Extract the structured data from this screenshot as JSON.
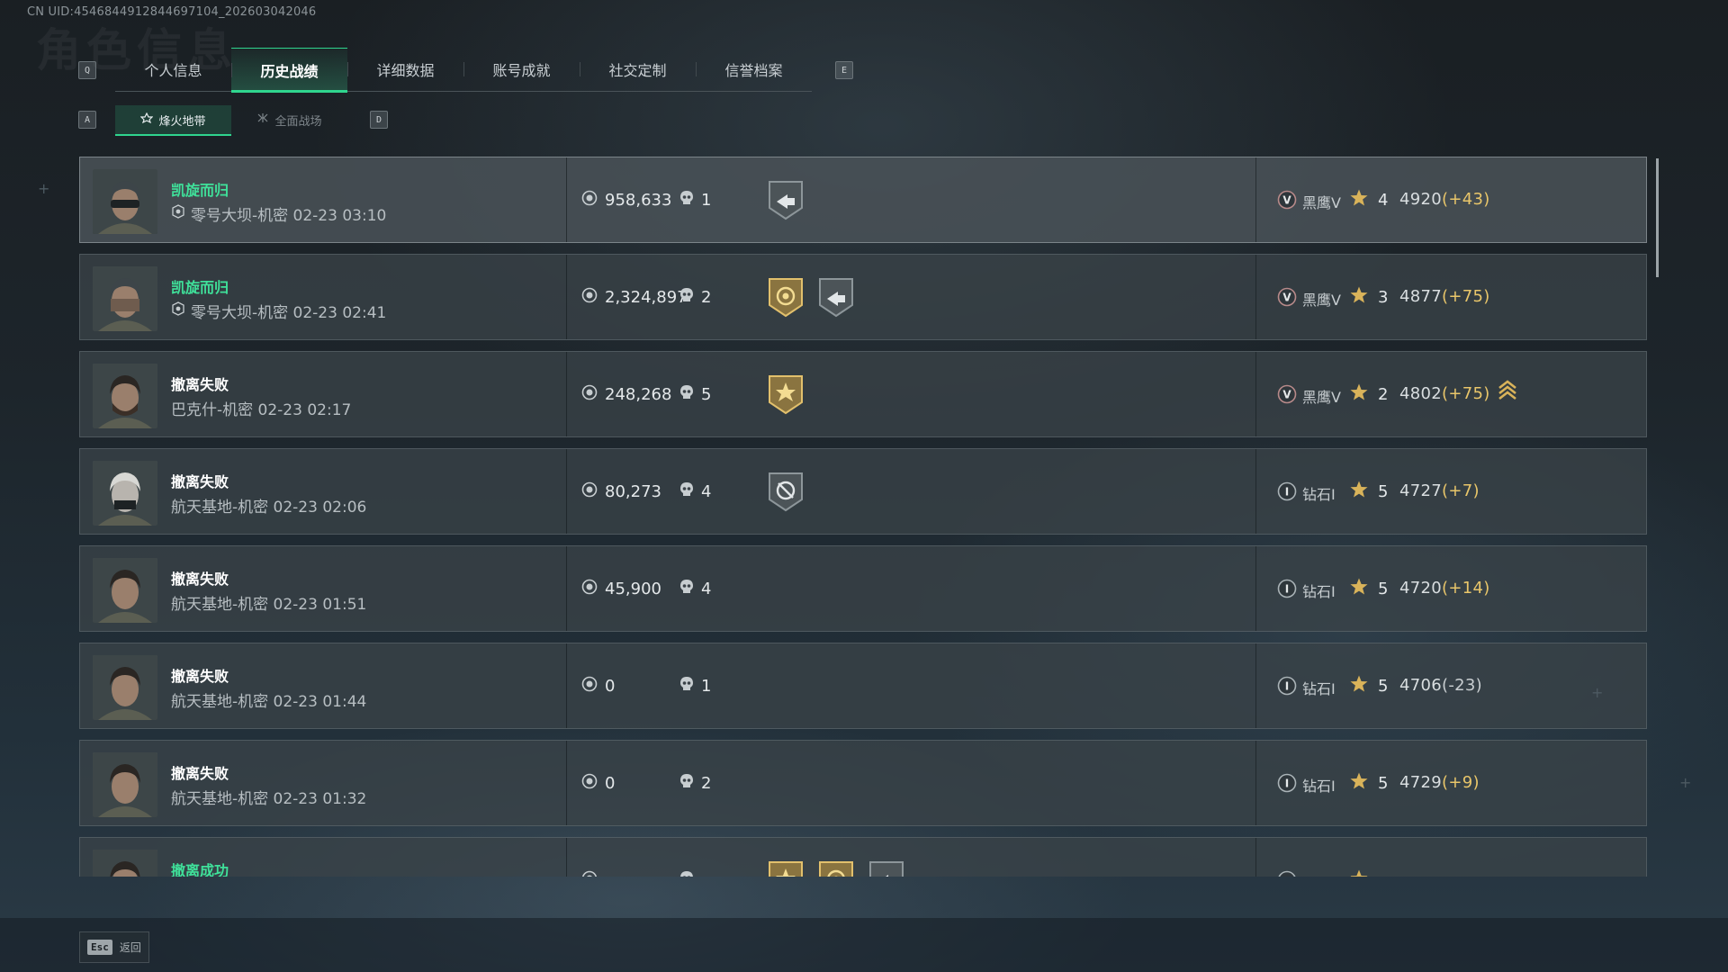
{
  "uid_text": "CN UID:4546844912844697104_202603042046",
  "ghost_title": "角色信息",
  "keys": {
    "tab_prev": "Q",
    "tab_next": "E",
    "sub_prev": "A",
    "sub_next": "D"
  },
  "tabs": [
    {
      "label": "个人信息",
      "active": false
    },
    {
      "label": "历史战绩",
      "active": true
    },
    {
      "label": "详细数据",
      "active": false
    },
    {
      "label": "账号成就",
      "active": false
    },
    {
      "label": "社交定制",
      "active": false
    },
    {
      "label": "信誉档案",
      "active": false
    }
  ],
  "subtabs": [
    {
      "label": "烽火地带",
      "active": true
    },
    {
      "label": "全面战场",
      "active": false
    }
  ],
  "rows": [
    {
      "result": "凯旋而归",
      "success": true,
      "map": "零号大坝-机密 02-23 03:10",
      "map_icon": true,
      "money": "958,633",
      "kills": "1",
      "badges": [
        "extract-grey"
      ],
      "rank": "黑鹰V",
      "rank_numeral": "V",
      "rank_tier": "blackhawk",
      "stars": "4",
      "score": "4920",
      "delta": "(+43)",
      "promo": false,
      "avatar": "helmet"
    },
    {
      "result": "凯旋而归",
      "success": true,
      "map": "零号大坝-机密 02-23 02:41",
      "map_icon": true,
      "money": "2,324,897",
      "kills": "2",
      "badges": [
        "gold-target",
        "extract-grey"
      ],
      "rank": "黑鹰V",
      "rank_numeral": "V",
      "rank_tier": "blackhawk",
      "stars": "3",
      "score": "4877",
      "delta": "(+75)",
      "promo": false,
      "avatar": "masked"
    },
    {
      "result": "撤离失败",
      "success": false,
      "map": "巴克什-机密 02-23 02:17",
      "map_icon": false,
      "money": "248,268",
      "kills": "5",
      "badges": [
        "gold-burst"
      ],
      "rank": "黑鹰V",
      "rank_numeral": "V",
      "rank_tier": "blackhawk",
      "stars": "2",
      "score": "4802",
      "delta": "(+75)",
      "promo": true,
      "avatar": "bearded"
    },
    {
      "result": "撤离失败",
      "success": false,
      "map": "航天基地-机密 02-23 02:06",
      "map_icon": false,
      "money": "80,273",
      "kills": "4",
      "badges": [
        "grey-cycle"
      ],
      "rank": "钻石I",
      "rank_numeral": "I",
      "rank_tier": "diamond",
      "stars": "5",
      "score": "4727",
      "delta": "(+7)",
      "promo": false,
      "avatar": "whitehair"
    },
    {
      "result": "撤离失败",
      "success": false,
      "map": "航天基地-机密 02-23 01:51",
      "map_icon": false,
      "money": "45,900",
      "kills": "4",
      "badges": [],
      "rank": "钻石I",
      "rank_numeral": "I",
      "rank_tier": "diamond",
      "stars": "5",
      "score": "4720",
      "delta": "(+14)",
      "promo": false,
      "avatar": "woman"
    },
    {
      "result": "撤离失败",
      "success": false,
      "map": "航天基地-机密 02-23 01:44",
      "map_icon": false,
      "money": "0",
      "kills": "1",
      "badges": [],
      "rank": "钻石I",
      "rank_numeral": "I",
      "rank_tier": "diamond",
      "stars": "5",
      "score": "4706",
      "delta": "(-23)",
      "promo": false,
      "avatar": "woman"
    },
    {
      "result": "撤离失败",
      "success": false,
      "map": "航天基地-机密 02-23 01:32",
      "map_icon": false,
      "money": "0",
      "kills": "2",
      "badges": [],
      "rank": "钻石I",
      "rank_numeral": "I",
      "rank_tier": "diamond",
      "stars": "5",
      "score": "4729",
      "delta": "(+9)",
      "promo": false,
      "avatar": "woman"
    },
    {
      "result": "撤离成功",
      "success": true,
      "map": "",
      "map_icon": false,
      "money": "",
      "kills": "",
      "badges": [
        "gold-burst",
        "gold-target",
        "extract-grey"
      ],
      "rank": "",
      "rank_numeral": "",
      "rank_tier": "diamond",
      "stars": "",
      "score": "",
      "delta": "",
      "promo": false,
      "avatar": "woman"
    }
  ],
  "footer": {
    "key": "Esc",
    "label": "返回"
  },
  "colors": {
    "accent_green": "#2fd58e",
    "success_text": "#3fe19a",
    "delta_gold": "#e9c66a"
  }
}
